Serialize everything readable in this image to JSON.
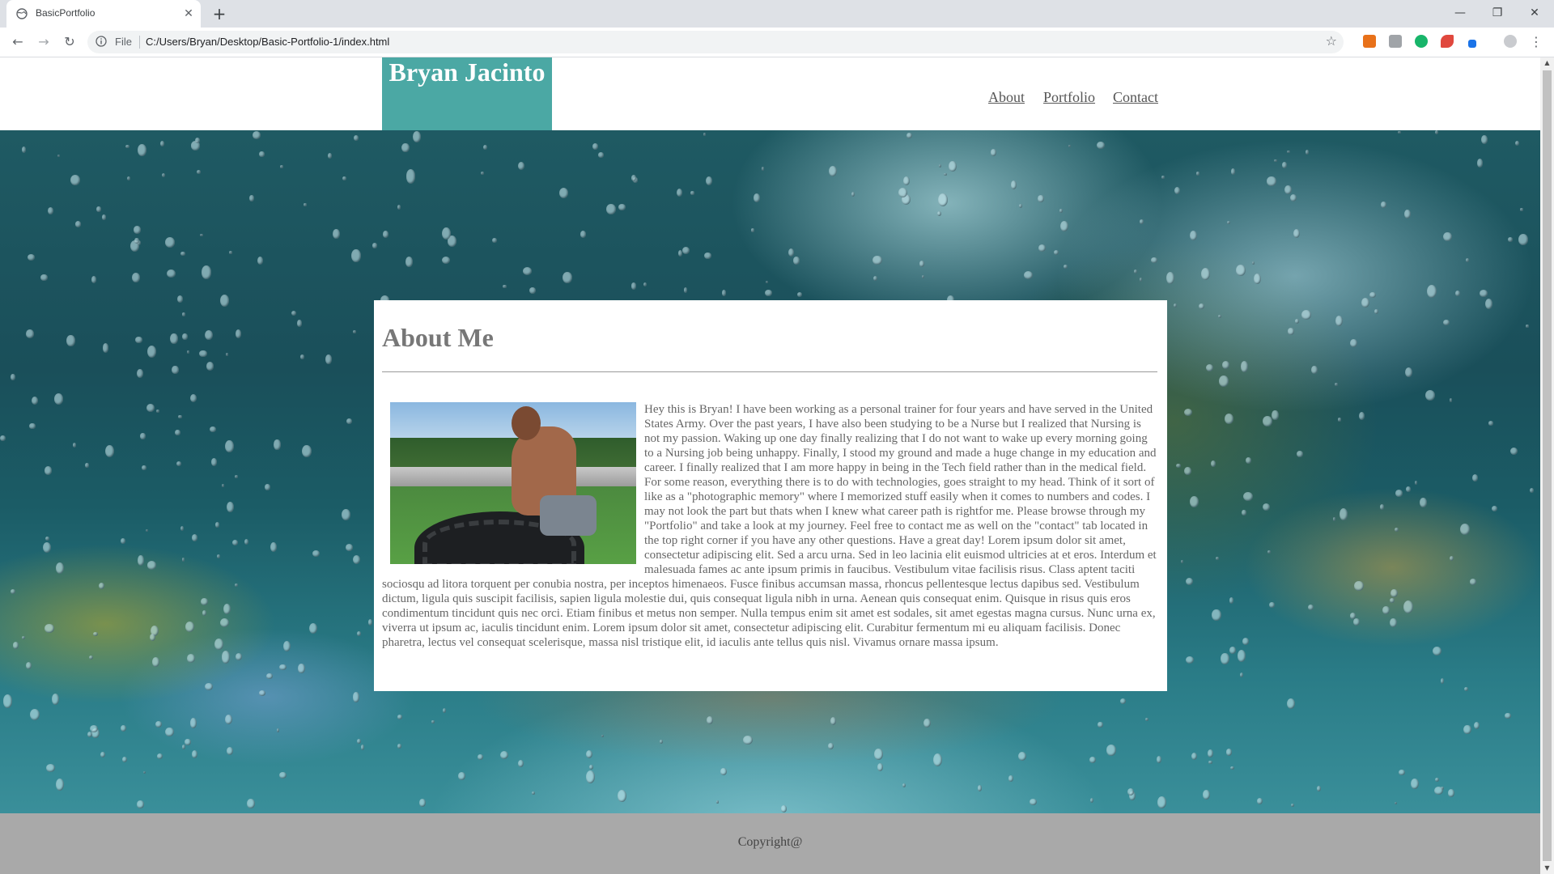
{
  "browser": {
    "tab_title": "BasicPortfolio",
    "tab_close": "✕",
    "new_tab": "+",
    "window_controls": {
      "minimize": "—",
      "restore": "❐",
      "close": "✕"
    },
    "nav": {
      "back": "←",
      "forward": "→",
      "reload": "↻"
    },
    "address": {
      "scheme_label": "File",
      "url": "C:/Users/Bryan/Desktop/Basic-Portfolio-1/index.html",
      "star": "☆"
    },
    "extension_colors": [
      "#e8711a",
      "#a0a4a8",
      "#18b56a",
      "#e0483e",
      "#1a73e8",
      "#c9cbcf"
    ]
  },
  "header": {
    "brand": "Bryan Jacinto",
    "brand_color": "#4ba8a4",
    "nav": [
      {
        "label": "About"
      },
      {
        "label": "Portfolio"
      },
      {
        "label": "Contact"
      }
    ]
  },
  "about": {
    "title": "About Me",
    "photo_icon": "person-flipping-tire-photo",
    "body": "Hey this is Bryan! I have been working as a personal trainer for four years and have served in the United States Army. Over the past years, I have also been studying to be a Nurse but I realized that Nursing is not my passion. Waking up one day finally realizing that I do not want to wake up every morning going to a Nursing job being unhappy. Finally, I stood my ground and made a huge change in my education and career. I finally realized that I am more happy in being in the Tech field rather than in the medical field. For some reason, everything there is to do with technologies, goes straight to my head. Think of it sort of like as a \"photographic memory\" where I memorized stuff easily when it comes to numbers and codes. I may not look the part but thats when I knew what career path is rightfor me. Please browse through my \"Portfolio\" and take a look at my journey. Feel free to contact me as well on the \"contact\" tab located in the top right corner if you have any other questions. Have a great day! Lorem ipsum dolor sit amet, consectetur adipiscing elit. Sed a arcu urna. Sed in leo lacinia elit euismod ultricies at et eros. Interdum et malesuada fames ac ante ipsum primis in faucibus. Vestibulum vitae facilisis risus. Class aptent taciti sociosqu ad litora torquent per conubia nostra, per inceptos himenaeos. Fusce finibus accumsan massa, rhoncus pellentesque lectus dapibus sed. Vestibulum dictum, ligula quis suscipit facilisis, sapien ligula molestie dui, quis consequat ligula nibh in urna. Aenean quis consequat enim. Quisque in risus quis eros condimentum tincidunt quis nec orci. Etiam finibus et metus non semper. Nulla tempus enim sit amet est sodales, sit amet egestas magna cursus. Nunc urna ex, viverra ut ipsum ac, iaculis tincidunt enim. Lorem ipsum dolor sit amet, consectetur adipiscing elit. Curabitur fermentum mi eu aliquam facilisis. Donec pharetra, lectus vel consequat scelerisque, massa nisl tristique elit, id iaculis ante tellus quis nisl. Vivamus ornare massa ipsum."
  },
  "footer": {
    "text": "Copyright@"
  },
  "hero_background": "rain-droplets-on-glass-teal-bokeh"
}
